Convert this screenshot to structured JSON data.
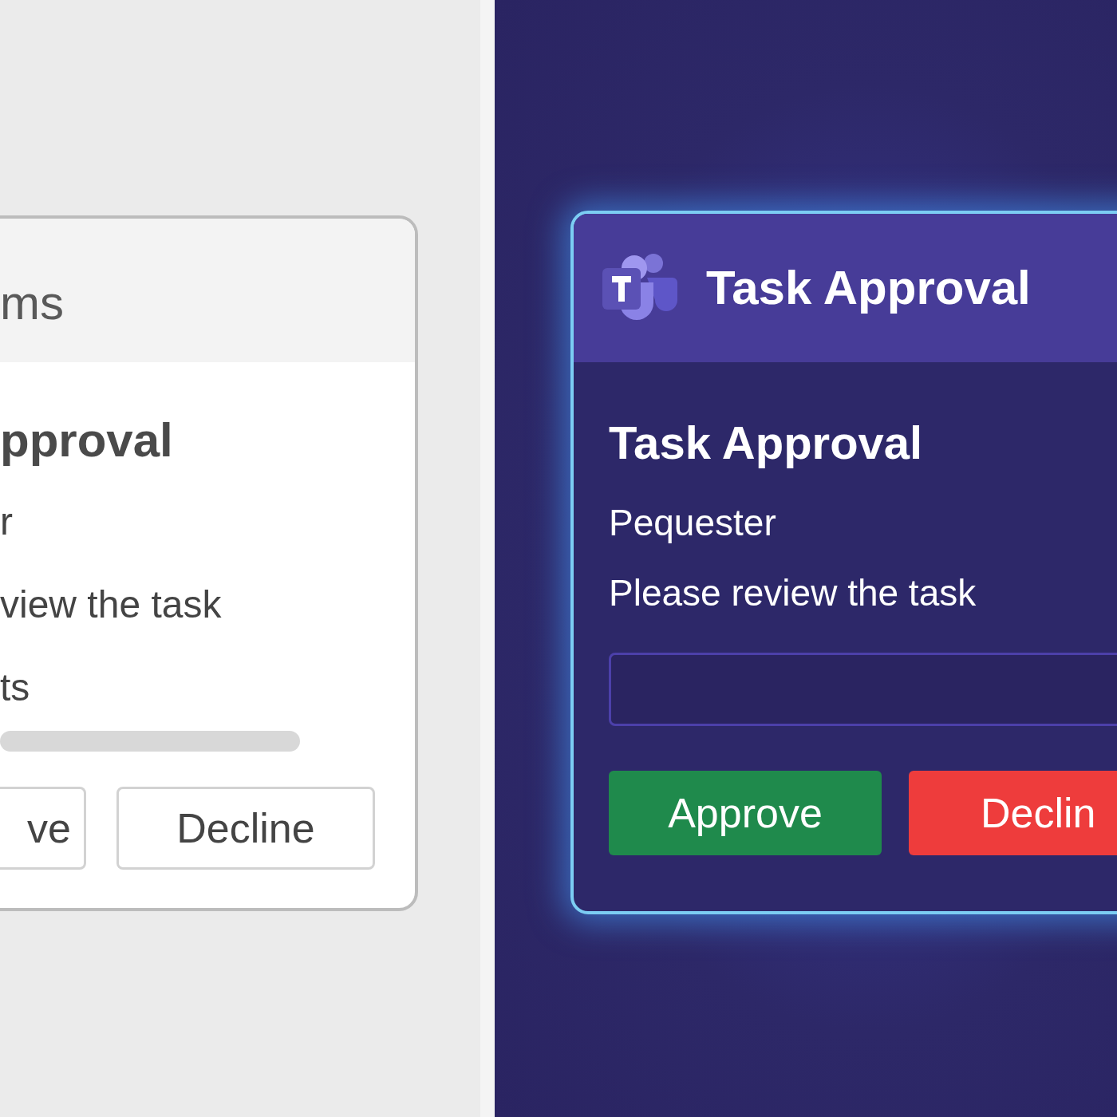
{
  "panels": [
    {
      "kind": "light",
      "header": "ms",
      "title": "pproval",
      "lines": [
        "r",
        "view the task",
        "ts"
      ],
      "buttons": [
        {
          "label": "ve",
          "kind": "outline"
        },
        {
          "label": "Decline",
          "kind": "outline"
        }
      ]
    },
    {
      "kind": "dark",
      "header": "Task Approval",
      "title": "Task Approval",
      "lines": [
        "Pequester",
        "Please review the task"
      ],
      "buttons": [
        {
          "label": "Approve",
          "kind": "approve"
        },
        {
          "label": "Declin",
          "kind": "decline"
        }
      ]
    }
  ]
}
